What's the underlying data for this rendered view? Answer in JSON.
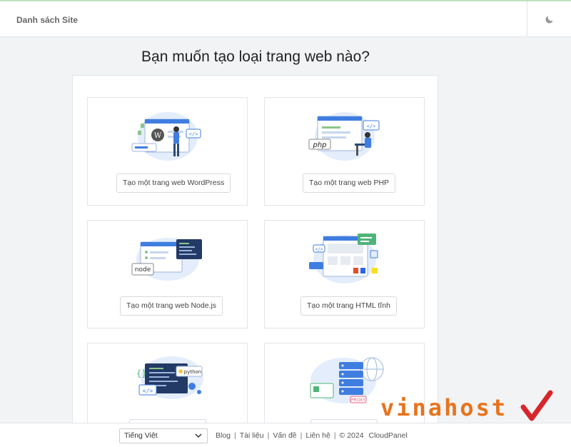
{
  "header": {
    "site_list_label": "Danh sách Site",
    "theme_icon": "moon-icon"
  },
  "page_title": "Bạn muốn tạo loại trang web nào?",
  "cards": [
    {
      "label": "Tạo một trang web WordPress",
      "icon": "wordpress-illustration"
    },
    {
      "label": "Tạo một trang web PHP",
      "icon": "php-illustration",
      "illustration_text": "php"
    },
    {
      "label": "Tạo một trang web Node.js",
      "icon": "nodejs-illustration",
      "illustration_text": "node"
    },
    {
      "label": "Tạo một trang HTML tĩnh",
      "icon": "html-illustration"
    },
    {
      "label": "",
      "icon": "python-illustration",
      "illustration_text": "python"
    },
    {
      "label": "",
      "icon": "proxy-illustration",
      "illustration_text": "PROXY"
    }
  ],
  "footer": {
    "language_selected": "Tiếng Việt",
    "links": [
      "Blog",
      "Tài liệu",
      "Vấn đề",
      "Liên hệ"
    ],
    "copyright": "© 2024",
    "product": "CloudPanel"
  },
  "watermark": {
    "text": "vinahost"
  },
  "colors": {
    "accent_blue": "#3f7de0",
    "watermark_orange": "#e8731c",
    "watermark_red": "#d6262c"
  }
}
